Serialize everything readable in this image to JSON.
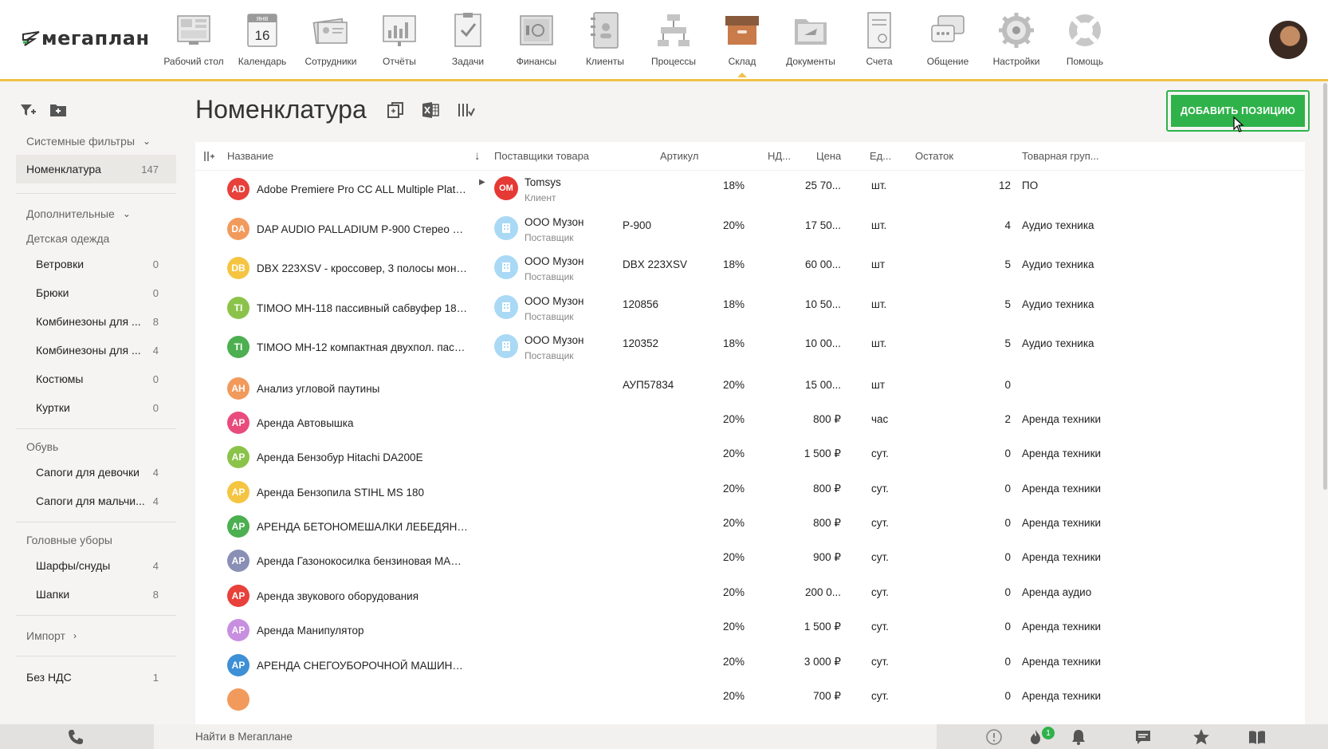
{
  "app": {
    "logo_text": "мегаплан"
  },
  "nav": [
    {
      "label": "Рабочий стол",
      "icon": "desktop-icon"
    },
    {
      "label": "Календарь",
      "icon": "calendar-icon",
      "day": "16",
      "month": "ЯНВ"
    },
    {
      "label": "Сотрудники",
      "icon": "employees-icon"
    },
    {
      "label": "Отчёты",
      "icon": "reports-icon"
    },
    {
      "label": "Задачи",
      "icon": "tasks-icon"
    },
    {
      "label": "Финансы",
      "icon": "finance-icon"
    },
    {
      "label": "Клиенты",
      "icon": "clients-icon"
    },
    {
      "label": "Процессы",
      "icon": "processes-icon"
    },
    {
      "label": "Склад",
      "icon": "warehouse-icon",
      "active": true
    },
    {
      "label": "Документы",
      "icon": "documents-icon"
    },
    {
      "label": "Счета",
      "icon": "invoices-icon"
    },
    {
      "label": "Общение",
      "icon": "chat-icon"
    },
    {
      "label": "Настройки",
      "icon": "settings-icon"
    },
    {
      "label": "Помощь",
      "icon": "help-icon"
    }
  ],
  "sidebar": {
    "system_filters": "Системные фильтры",
    "nomenclature": {
      "label": "Номенклатура",
      "count": "147"
    },
    "additional": "Дополнительные",
    "groups": [
      {
        "title": "Детская одежда",
        "items": [
          {
            "label": "Ветровки",
            "count": "0"
          },
          {
            "label": "Брюки",
            "count": "0"
          },
          {
            "label": "Комбинезоны для ...",
            "count": "8"
          },
          {
            "label": "Комбинезоны для ...",
            "count": "4"
          },
          {
            "label": "Костюмы",
            "count": "0"
          },
          {
            "label": "Куртки",
            "count": "0"
          }
        ]
      },
      {
        "title": "Обувь",
        "items": [
          {
            "label": "Сапоги для девочки",
            "count": "4"
          },
          {
            "label": "Сапоги для мальчи...",
            "count": "4"
          }
        ]
      },
      {
        "title": "Головные уборы",
        "items": [
          {
            "label": "Шарфы/снуды",
            "count": "4"
          },
          {
            "label": "Шапки",
            "count": "8"
          }
        ]
      }
    ],
    "import": "Импорт",
    "no_vat": {
      "label": "Без НДС",
      "count": "1"
    }
  },
  "page": {
    "title": "Номенклатура",
    "add_button": "ДОБАВИТЬ ПОЗИЦИЮ"
  },
  "table": {
    "columns": {
      "name": "Название",
      "suppliers": "Поставщики товара",
      "sku": "Артикул",
      "vat": "НД...",
      "price": "Цена",
      "unit": "Ед...",
      "stock": "Остаток",
      "group": "Товарная груп..."
    },
    "rows": [
      {
        "badge": "AD",
        "color": "#e8403a",
        "name": "Adobe Premiere Pro CC ALL Multiple Platfo...",
        "supplier": "Tomsys",
        "role": "Клиент",
        "supplier_type": "logo",
        "sku": "",
        "vat": "18%",
        "price": "25 70...",
        "unit": "шт.",
        "stock": "12",
        "group": "ПО"
      },
      {
        "badge": "DA",
        "color": "#f29a5c",
        "name": "DAP AUDIO PALLADIUM P-900 Стерео уси...",
        "supplier": "ООО Музон",
        "role": "Поставщик",
        "supplier_type": "company",
        "sku": "P-900",
        "vat": "20%",
        "price": "17 50...",
        "unit": "шт.",
        "stock": "4",
        "group": "Аудио техника"
      },
      {
        "badge": "DB",
        "color": "#f5c542",
        "name": "DBX 223XSV - кроссовер, 3 полосы моно-,...",
        "supplier": "ООО Музон",
        "role": "Поставщик",
        "supplier_type": "company",
        "sku": "DBX 223XSV",
        "vat": "18%",
        "price": "60 00...",
        "unit": "шт",
        "stock": "5",
        "group": "Аудио техника"
      },
      {
        "badge": "TI",
        "color": "#8bc34a",
        "name": "TIMOO MH-118 пассивный сабвуфер 18 \",...",
        "supplier": "ООО Музон",
        "role": "Поставщик",
        "supplier_type": "company",
        "sku": "120856",
        "vat": "18%",
        "price": "10 50...",
        "unit": "шт.",
        "stock": "5",
        "group": "Аудио техника"
      },
      {
        "badge": "TI",
        "color": "#4caf50",
        "name": "TIMOO MH-12 компактная двухпол. пасс....",
        "supplier": "ООО Музон",
        "role": "Поставщик",
        "supplier_type": "company",
        "sku": "120352",
        "vat": "18%",
        "price": "10 00...",
        "unit": "шт.",
        "stock": "5",
        "group": "Аудио техника"
      },
      {
        "badge": "АН",
        "color": "#f29a5c",
        "name": "Анализ угловой паутины",
        "supplier": "",
        "role": "",
        "supplier_type": "",
        "sku": "АУП57834",
        "vat": "20%",
        "price": "15 00...",
        "unit": "шт",
        "stock": "0",
        "group": ""
      },
      {
        "badge": "АР",
        "color": "#e94b7d",
        "name": "Аренда Автовышка",
        "supplier": "",
        "role": "",
        "supplier_type": "",
        "sku": "",
        "vat": "20%",
        "price": "800 ₽",
        "unit": "час",
        "stock": "2",
        "group": "Аренда техники"
      },
      {
        "badge": "АР",
        "color": "#8bc34a",
        "name": "Аренда Бензобур Hitachi DA200E",
        "supplier": "",
        "role": "",
        "supplier_type": "",
        "sku": "",
        "vat": "20%",
        "price": "1 500 ₽",
        "unit": "сут.",
        "stock": "0",
        "group": "Аренда техники"
      },
      {
        "badge": "АР",
        "color": "#f5c542",
        "name": "Аренда Бензопила STIHL MS 180",
        "supplier": "",
        "role": "",
        "supplier_type": "",
        "sku": "",
        "vat": "20%",
        "price": "800 ₽",
        "unit": "сут.",
        "stock": "0",
        "group": "Аренда техники"
      },
      {
        "badge": "АР",
        "color": "#4caf50",
        "name": "АРЕНДА БЕТОНОМЕШАЛКИ ЛЕБЕДЯНЬ ...",
        "supplier": "",
        "role": "",
        "supplier_type": "",
        "sku": "",
        "vat": "20%",
        "price": "800 ₽",
        "unit": "сут.",
        "stock": "0",
        "group": "Аренда техники"
      },
      {
        "badge": "АР",
        "color": "#8a8fb5",
        "name": "Аренда Газонокосилка бензиновая MAKI...",
        "supplier": "",
        "role": "",
        "supplier_type": "",
        "sku": "",
        "vat": "20%",
        "price": "900 ₽",
        "unit": "сут.",
        "stock": "0",
        "group": "Аренда техники"
      },
      {
        "badge": "АР",
        "color": "#e8403a",
        "name": "Аренда звукового оборудования",
        "supplier": "",
        "role": "",
        "supplier_type": "",
        "sku": "",
        "vat": "20%",
        "price": "200 0...",
        "unit": "сут.",
        "stock": "0",
        "group": "Аренда аудио"
      },
      {
        "badge": "АР",
        "color": "#c88ee0",
        "name": "Аренда Манипулятор",
        "supplier": "",
        "role": "",
        "supplier_type": "",
        "sku": "",
        "vat": "20%",
        "price": "1 500 ₽",
        "unit": "сут.",
        "stock": "0",
        "group": "Аренда техники"
      },
      {
        "badge": "АР",
        "color": "#3d8fd6",
        "name": "АРЕНДА СНЕГОУБОРОЧНОЙ МАШИНЫ Р...",
        "supplier": "",
        "role": "",
        "supplier_type": "",
        "sku": "",
        "vat": "20%",
        "price": "3 000 ₽",
        "unit": "сут.",
        "stock": "0",
        "group": "Аренда техники"
      },
      {
        "badge": "",
        "color": "#f29a5c",
        "name": "",
        "supplier": "",
        "role": "",
        "supplier_type": "",
        "sku": "",
        "vat": "20%",
        "price": "700 ₽",
        "unit": "сут.",
        "stock": "0",
        "group": "Аренда техники"
      }
    ]
  },
  "bottombar": {
    "search_placeholder": "Найти в Мегаплане",
    "notif_count": "1"
  },
  "colors": {
    "accent": "#f0c24a",
    "primary_button": "#2fb24a"
  }
}
